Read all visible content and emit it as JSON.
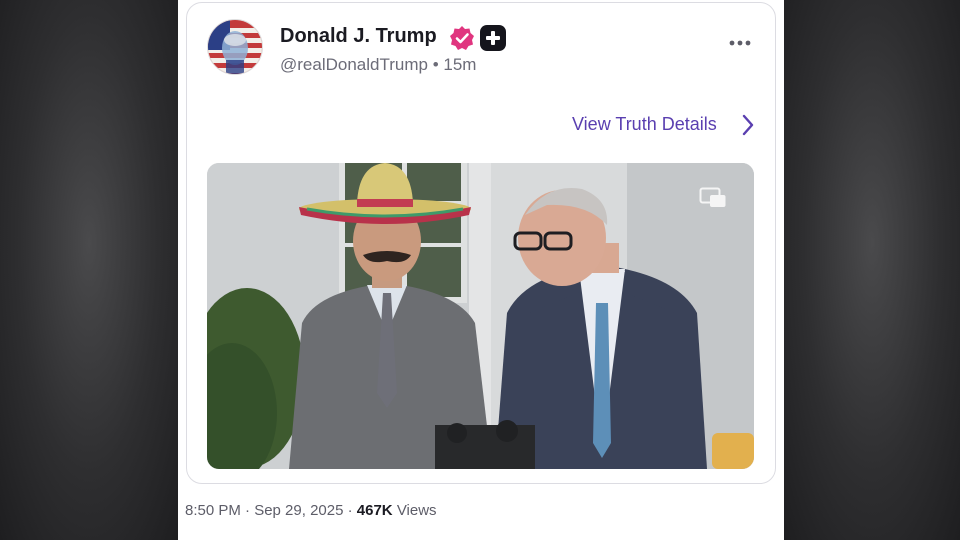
{
  "post": {
    "author_name": "Donald J. Trump",
    "handle": "@realDonaldTrump",
    "separator": "•",
    "time_ago": "15m",
    "details_link": "View Truth Details",
    "media_alt": "Video still of two men in suits speaking outside a white building; one wears a digitally added sombrero and mustache",
    "timestamp": "8:50 PM · Sep 29, 2025 ·",
    "views_count": "467K",
    "views_label": "Views"
  },
  "icons": {
    "verified": "verified-badge-icon",
    "plus": "plus-badge-icon",
    "more": "more-options-icon",
    "chevron": "chevron-right-icon",
    "pip": "picture-in-picture-icon"
  },
  "colors": {
    "link": "#5a3fb0",
    "verified": "#e0357f",
    "name": "#1b1b22",
    "secondary": "#6c6c78"
  }
}
